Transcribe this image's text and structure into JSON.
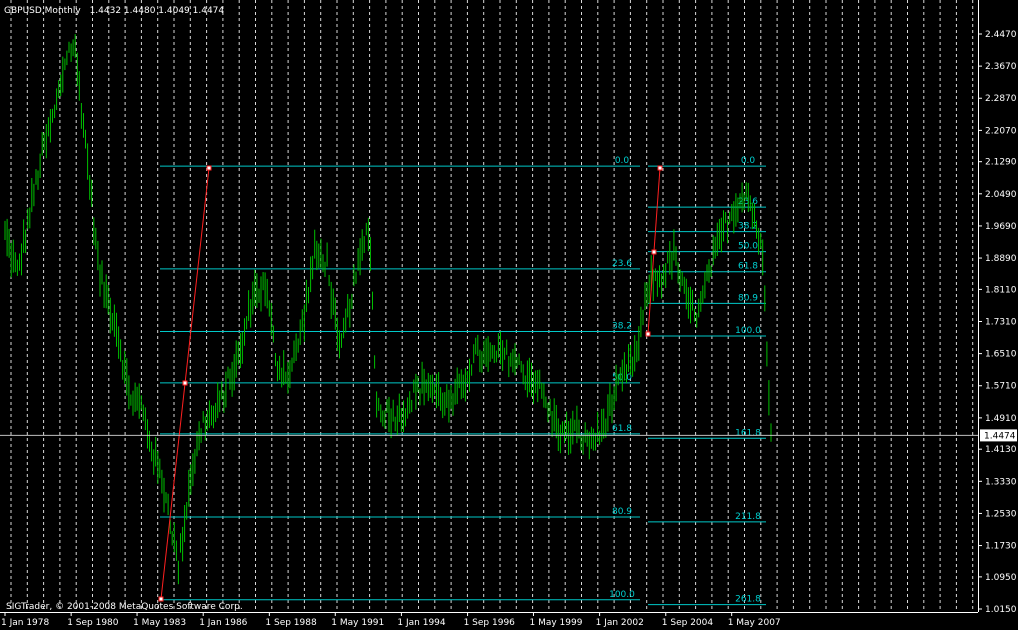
{
  "header": {
    "symbol": "GBPUSD,Monthly",
    "ohlc": "1.4432 1.4480 1.4049 1.4474"
  },
  "footer": {
    "copyright": "SIGTrader, © 2001-2008 MetaQuotes Software Corp."
  },
  "colors": {
    "background": "#000000",
    "bars": "#00c000",
    "fib": "#00c8c8",
    "fib_label": "#00d0d0",
    "trend": "#ff2020",
    "grid": "#ffffff",
    "price_line": "#c0c0c0",
    "axis_text": "#ffffff"
  },
  "chart_data": {
    "type": "bar",
    "title": "GBPUSD,Monthly",
    "x_start": "1978-01",
    "x_end": "2008-12",
    "ylim": [
      1.0,
      2.52
    ],
    "current_price": "1.4474",
    "grid": "dashed vertical",
    "y_ticks": [
      "2.4470",
      "2.3670",
      "2.2870",
      "2.2070",
      "2.1290",
      "2.0490",
      "1.9690",
      "1.8890",
      "1.8110",
      "1.7310",
      "1.6510",
      "1.5710",
      "1.4910",
      "1.4130",
      "1.3330",
      "1.2530",
      "1.1730",
      "1.0950",
      "1.0150"
    ],
    "x_ticks": [
      {
        "label": "1 Jan 1978",
        "t": 1978.0
      },
      {
        "label": "1 Sep 1980",
        "t": 1980.67
      },
      {
        "label": "1 May 1983",
        "t": 1983.33
      },
      {
        "label": "1 Jan 1986",
        "t": 1986.0
      },
      {
        "label": "1 Sep 1988",
        "t": 1988.67
      },
      {
        "label": "1 May 1991",
        "t": 1991.33
      },
      {
        "label": "1 Jan 1994",
        "t": 1994.0
      },
      {
        "label": "1 Sep 1996",
        "t": 1996.67
      },
      {
        "label": "1 May 1999",
        "t": 1999.33
      },
      {
        "label": "1 Jan 2002",
        "t": 2002.0
      },
      {
        "label": "1 Sep 2004",
        "t": 2004.67
      },
      {
        "label": "1 May 2007",
        "t": 2007.33
      }
    ],
    "price_path": [
      [
        1978.0,
        1.95
      ],
      [
        1978.5,
        1.85
      ],
      [
        1979.0,
        2.0
      ],
      [
        1979.5,
        2.15
      ],
      [
        1980.0,
        2.25
      ],
      [
        1980.5,
        2.4
      ],
      [
        1980.8,
        2.42
      ],
      [
        1981.3,
        2.15
      ],
      [
        1981.8,
        1.85
      ],
      [
        1982.5,
        1.72
      ],
      [
        1983.0,
        1.55
      ],
      [
        1983.5,
        1.52
      ],
      [
        1984.0,
        1.4
      ],
      [
        1984.5,
        1.3
      ],
      [
        1985.0,
        1.12
      ],
      [
        1985.5,
        1.35
      ],
      [
        1986.0,
        1.48
      ],
      [
        1986.5,
        1.5
      ],
      [
        1987.0,
        1.58
      ],
      [
        1987.5,
        1.65
      ],
      [
        1988.0,
        1.8
      ],
      [
        1988.5,
        1.82
      ],
      [
        1989.0,
        1.62
      ],
      [
        1989.5,
        1.6
      ],
      [
        1990.0,
        1.72
      ],
      [
        1990.5,
        1.9
      ],
      [
        1991.0,
        1.88
      ],
      [
        1991.5,
        1.65
      ],
      [
        1992.0,
        1.8
      ],
      [
        1992.7,
        1.98
      ],
      [
        1993.0,
        1.52
      ],
      [
        1993.5,
        1.5
      ],
      [
        1994.0,
        1.5
      ],
      [
        1994.5,
        1.55
      ],
      [
        1995.0,
        1.58
      ],
      [
        1995.5,
        1.55
      ],
      [
        1996.0,
        1.52
      ],
      [
        1996.5,
        1.58
      ],
      [
        1997.0,
        1.65
      ],
      [
        1997.5,
        1.64
      ],
      [
        1998.0,
        1.65
      ],
      [
        1998.5,
        1.64
      ],
      [
        1999.0,
        1.6
      ],
      [
        1999.5,
        1.58
      ],
      [
        2000.0,
        1.5
      ],
      [
        2000.5,
        1.45
      ],
      [
        2001.0,
        1.46
      ],
      [
        2001.5,
        1.43
      ],
      [
        2002.0,
        1.45
      ],
      [
        2002.5,
        1.53
      ],
      [
        2003.0,
        1.6
      ],
      [
        2003.5,
        1.65
      ],
      [
        2004.0,
        1.83
      ],
      [
        2004.5,
        1.84
      ],
      [
        2005.0,
        1.9
      ],
      [
        2005.5,
        1.78
      ],
      [
        2006.0,
        1.75
      ],
      [
        2006.5,
        1.87
      ],
      [
        2007.0,
        1.96
      ],
      [
        2007.5,
        2.02
      ],
      [
        2007.9,
        2.06
      ],
      [
        2008.3,
        1.98
      ],
      [
        2008.6,
        1.88
      ],
      [
        2008.8,
        1.6
      ],
      [
        2008.95,
        1.44
      ]
    ],
    "fib_levels_left": {
      "x_start": 1983.33,
      "x_end": 2004.45,
      "levels": [
        {
          "label": "0.0",
          "price": 2.118
        },
        {
          "label": "23.6",
          "price": 1.862
        },
        {
          "label": "38.2",
          "price": 1.706
        },
        {
          "label": "50.0",
          "price": 1.578
        },
        {
          "label": "61.8",
          "price": 1.451
        },
        {
          "label": "80.9",
          "price": 1.244
        },
        {
          "label": "100.0",
          "price": 1.038
        }
      ]
    },
    "fib_levels_right": {
      "x_start": 2004.45,
      "x_end": 2008.95,
      "levels": [
        {
          "label": "0.0",
          "price": 2.118
        },
        {
          "label": "23.6",
          "price": 2.016
        },
        {
          "label": "38.2",
          "price": 1.955
        },
        {
          "label": "50.0",
          "price": 1.905
        },
        {
          "label": "61.8",
          "price": 1.855
        },
        {
          "label": "80.9",
          "price": 1.776
        },
        {
          "label": "100.0",
          "price": 1.695
        },
        {
          "label": "161.8",
          "price": 1.44
        },
        {
          "label": "211.8",
          "price": 1.232
        },
        {
          "label": "261.8",
          "price": 1.026
        }
      ]
    },
    "trend_lines": [
      {
        "from": [
          1983.65,
          1.038
        ],
        "to": [
          1986.05,
          2.118
        ]
      },
      {
        "from": [
          2004.45,
          1.695
        ],
        "to": [
          2005.2,
          2.118
        ]
      }
    ]
  }
}
